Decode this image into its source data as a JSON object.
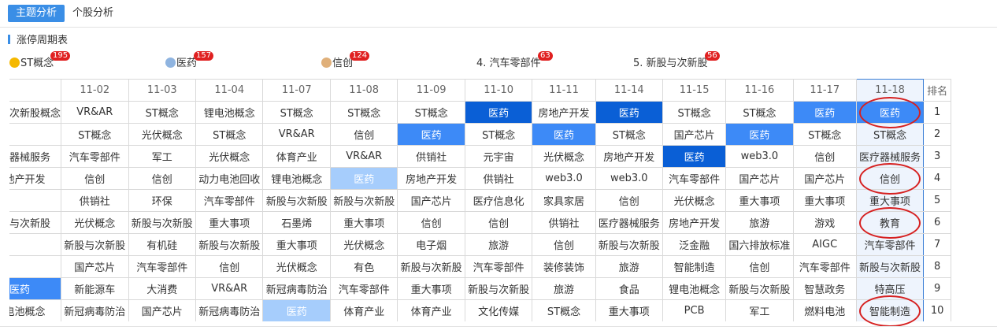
{
  "tabs": [
    {
      "label": "主题分析",
      "active": true
    },
    {
      "label": "个股分析",
      "active": false
    }
  ],
  "section_title": "涨停周期表",
  "themes": [
    {
      "rank_label": "",
      "medal": "gold",
      "name": "ST概念",
      "count": "195"
    },
    {
      "rank_label": "",
      "medal": "silver",
      "name": "医药",
      "count": "157"
    },
    {
      "rank_label": "",
      "medal": "bronze",
      "name": "信创",
      "count": "124"
    },
    {
      "rank_label": "4. ",
      "medal": "",
      "name": "汽车零部件",
      "count": "63"
    },
    {
      "rank_label": "5. ",
      "medal": "",
      "name": "新股与次新股",
      "count": "56"
    }
  ],
  "table": {
    "rank_header": "排名",
    "dates": [
      "",
      "11-02",
      "11-03",
      "11-04",
      "11-07",
      "11-08",
      "11-09",
      "11-10",
      "11-11",
      "11-14",
      "11-15",
      "11-16",
      "11-17",
      "11-18"
    ],
    "rows": [
      {
        "rank": "1",
        "cells": [
          "新股与次新股概念",
          "VR&AR",
          "ST概念",
          "锂电池概念",
          "ST概念",
          "ST概念",
          "ST概念",
          "医药",
          "房地产开发",
          "医药",
          "ST概念",
          "ST概念",
          "医药",
          "医药"
        ]
      },
      {
        "rank": "2",
        "cells": [
          "",
          "ST概念",
          "光伏概念",
          "ST概念",
          "VR&AR",
          "信创",
          "医药",
          "ST概念",
          "医药",
          "ST概念",
          "国产芯片",
          "医药",
          "ST概念",
          "ST概念"
        ]
      },
      {
        "rank": "3",
        "cells": [
          "医疗器械服务",
          "汽车零部件",
          "军工",
          "光伏概念",
          "体育产业",
          "VR&AR",
          "供销社",
          "元宇宙",
          "光伏概念",
          "房地产开发",
          "医药",
          "web3.0",
          "信创",
          "医疗器械服务"
        ]
      },
      {
        "rank": "4",
        "cells": [
          "房地产开发",
          "信创",
          "信创",
          "动力电池回收",
          "锂电池概念",
          "医药",
          "房地产开发",
          "供销社",
          "web3.0",
          "web3.0",
          "汽车零部件",
          "国产芯片",
          "国产芯片",
          "信创"
        ]
      },
      {
        "rank": "5",
        "cells": [
          "",
          "供销社",
          "环保",
          "汽车零部件",
          "新股与次新股",
          "新股与次新股",
          "国产芯片",
          "医疗信息化",
          "家具家居",
          "信创",
          "光伏概念",
          "重大事项",
          "重大事项",
          "重大事项"
        ]
      },
      {
        "rank": "6",
        "cells": [
          "新股与次新股",
          "光伏概念",
          "新股与次新股",
          "重大事项",
          "石墨烯",
          "重大事项",
          "信创",
          "信创",
          "供销社",
          "医疗器械服务",
          "房地产开发",
          "旅游",
          "游戏",
          "教育"
        ]
      },
      {
        "rank": "7",
        "cells": [
          "",
          "新股与次新股",
          "有机硅",
          "新股与次新股",
          "重大事项",
          "光伏概念",
          "电子烟",
          "旅游",
          "信创",
          "新股与次新股",
          "泛金融",
          "国六排放标准",
          "AIGC",
          "汽车零部件"
        ]
      },
      {
        "rank": "8",
        "cells": [
          "",
          "国产芯片",
          "汽车零部件",
          "信创",
          "光伏概念",
          "有色",
          "新股与次新股",
          "汽车零部件",
          "装修装饰",
          "旅游",
          "智能制造",
          "信创",
          "汽车零部件",
          "新股与次新股"
        ]
      },
      {
        "rank": "9",
        "cells": [
          "医药",
          "新能源车",
          "大消费",
          "VR&AR",
          "新冠病毒防治",
          "汽车零部件",
          "重大事项",
          "新股与次新股",
          "旅游",
          "食品",
          "锂电池概念",
          "新股与次新股",
          "智慧政务",
          "特高压"
        ]
      },
      {
        "rank": "10",
        "cells": [
          "锂电池概念",
          "新冠病毒防治",
          "国产芯片",
          "新冠病毒防治",
          "医药",
          "体育产业",
          "体育产业",
          "文化传媒",
          "ST概念",
          "重大事项",
          "PCB",
          "军工",
          "燃料电池",
          "智能制造"
        ]
      }
    ],
    "highlights": [
      {
        "row": 0,
        "col": 7,
        "level": "dark"
      },
      {
        "row": 0,
        "col": 9,
        "level": "dark"
      },
      {
        "row": 0,
        "col": 12,
        "level": "med"
      },
      {
        "row": 0,
        "col": 13,
        "level": "med"
      },
      {
        "row": 1,
        "col": 6,
        "level": "med"
      },
      {
        "row": 1,
        "col": 8,
        "level": "med"
      },
      {
        "row": 1,
        "col": 11,
        "level": "med"
      },
      {
        "row": 2,
        "col": 10,
        "level": "dark"
      },
      {
        "row": 3,
        "col": 5,
        "level": "light"
      },
      {
        "row": 8,
        "col": 0,
        "level": "med"
      },
      {
        "row": 9,
        "col": 4,
        "level": "light"
      }
    ],
    "selected_col": 13,
    "circled": [
      0,
      3,
      5,
      9
    ]
  },
  "colors": {
    "accent": "#3a8ee6",
    "highlight_dark": "#0a5fd6",
    "highlight_med": "#3d8af7",
    "highlight_light": "#a6cdfc",
    "badge": "#e02020",
    "annotation": "#d62020"
  }
}
